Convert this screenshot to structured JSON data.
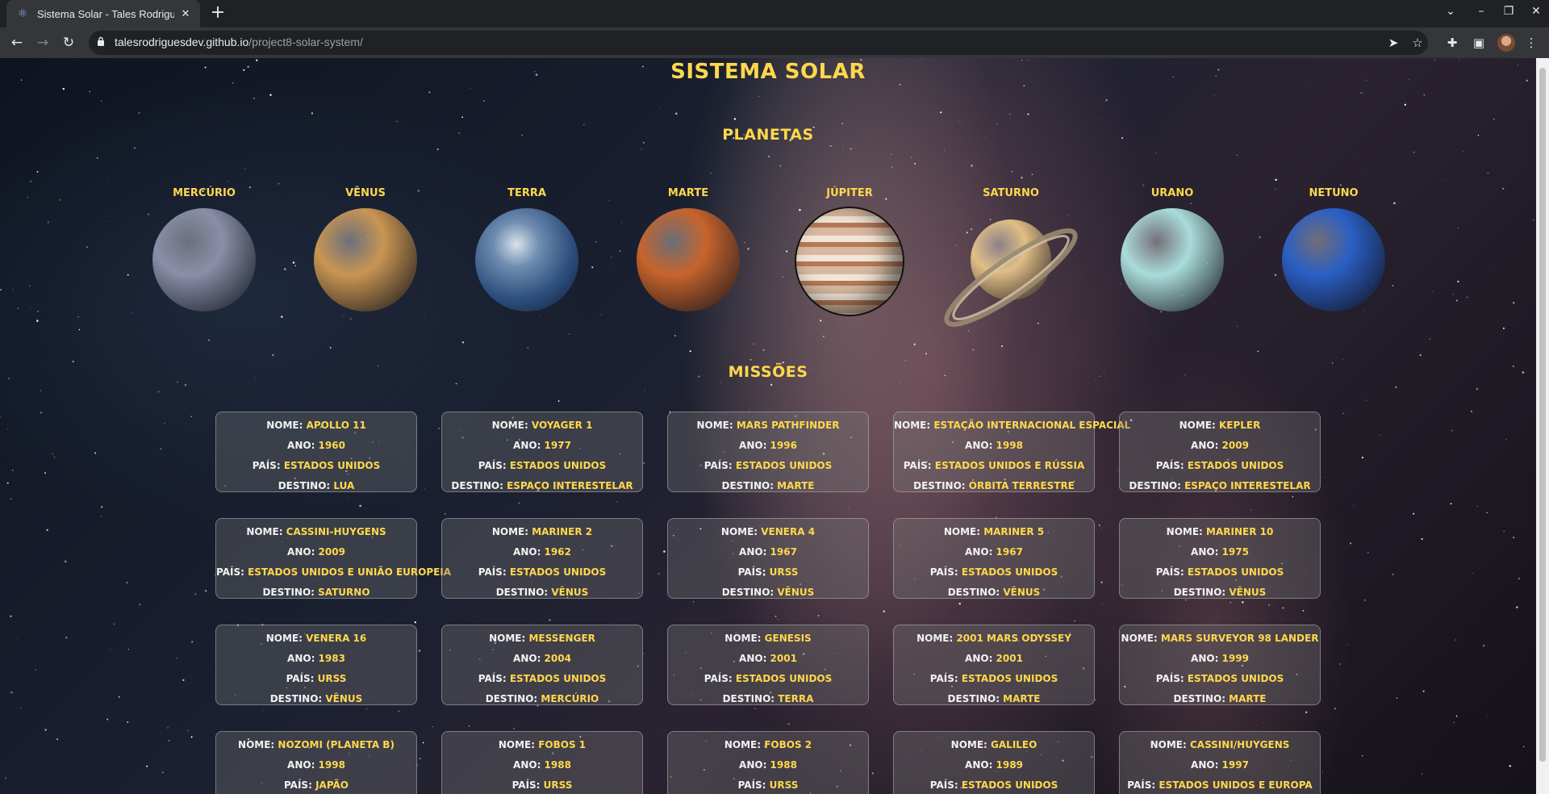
{
  "browser": {
    "tab_title": "Sistema Solar - Tales Rodrigues",
    "url_host": "talesrodriguesdev.github.io",
    "url_path": "/project8-solar-system/"
  },
  "page": {
    "title": "SISTEMA SOLAR",
    "planets_heading": "PLANETAS",
    "missions_heading": "MISSÕES"
  },
  "planets": [
    {
      "name": "MERCÚRIO",
      "color": "#8a8fa8"
    },
    {
      "name": "VÊNUS",
      "color": "#c99552"
    },
    {
      "name": "TERRA",
      "color": "#3b5c8f"
    },
    {
      "name": "MARTE",
      "color": "#c7642c"
    },
    {
      "name": "JÚPITER",
      "color": "#c9a184"
    },
    {
      "name": "SATURNO",
      "color": "#e0bf86"
    },
    {
      "name": "URANO",
      "color": "#a9dcd9"
    },
    {
      "name": "NETUNO",
      "color": "#2a5fc4"
    }
  ],
  "labels": {
    "name": "NOME: ",
    "year": "ANO: ",
    "country": "PAÍS: ",
    "destination": "DESTINO: "
  },
  "missions": [
    {
      "name": "APOLLO 11",
      "year": "1960",
      "country": "ESTADOS UNIDOS",
      "destination": "LUA"
    },
    {
      "name": "VOYAGER 1",
      "year": "1977",
      "country": "ESTADOS UNIDOS",
      "destination": "ESPAÇO INTERESTELAR"
    },
    {
      "name": "MARS PATHFINDER",
      "year": "1996",
      "country": "ESTADOS UNIDOS",
      "destination": "MARTE"
    },
    {
      "name": "ESTAÇÃO INTERNACIONAL ESPACIAL",
      "year": "1998",
      "country": "ESTADOS UNIDOS E RÚSSIA",
      "destination": "ÓRBITA TERRESTRE"
    },
    {
      "name": "KEPLER",
      "year": "2009",
      "country": "ESTADOS UNIDOS",
      "destination": "ESPAÇO INTERESTELAR"
    },
    {
      "name": "CASSINI-HUYGENS",
      "year": "2009",
      "country": "ESTADOS UNIDOS E UNIÃO EUROPEIA",
      "destination": "SATURNO"
    },
    {
      "name": "MARINER 2",
      "year": "1962",
      "country": "ESTADOS UNIDOS",
      "destination": "VÊNUS"
    },
    {
      "name": "VENERA 4",
      "year": "1967",
      "country": "URSS",
      "destination": "VÊNUS"
    },
    {
      "name": "MARINER 5",
      "year": "1967",
      "country": "ESTADOS UNIDOS",
      "destination": "VÊNUS"
    },
    {
      "name": "MARINER 10",
      "year": "1975",
      "country": "ESTADOS UNIDOS",
      "destination": "VÊNUS"
    },
    {
      "name": "VENERA 16",
      "year": "1983",
      "country": "URSS",
      "destination": "VÊNUS"
    },
    {
      "name": "MESSENGER",
      "year": "2004",
      "country": "ESTADOS UNIDOS",
      "destination": "MERCÚRIO"
    },
    {
      "name": "GENESIS",
      "year": "2001",
      "country": "ESTADOS UNIDOS",
      "destination": "TERRA"
    },
    {
      "name": "2001 MARS ODYSSEY",
      "year": "2001",
      "country": "ESTADOS UNIDOS",
      "destination": "MARTE"
    },
    {
      "name": "MARS SURVEYOR 98 LANDER",
      "year": "1999",
      "country": "ESTADOS UNIDOS",
      "destination": "MARTE"
    },
    {
      "name": "NOZOMI (PLANETA B)",
      "year": "1998",
      "country": "JAPÃO",
      "destination": ""
    },
    {
      "name": "FOBOS 1",
      "year": "1988",
      "country": "URSS",
      "destination": ""
    },
    {
      "name": "FOBOS 2",
      "year": "1988",
      "country": "URSS",
      "destination": ""
    },
    {
      "name": "GALILEO",
      "year": "1989",
      "country": "ESTADOS UNIDOS",
      "destination": ""
    },
    {
      "name": "CASSINI/HUYGENS",
      "year": "1997",
      "country": "ESTADOS UNIDOS E EUROPA",
      "destination": ""
    }
  ]
}
